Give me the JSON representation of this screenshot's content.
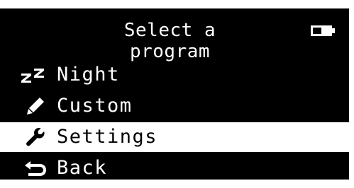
{
  "header": {
    "title": "Select a program",
    "battery_icon": "battery-icon"
  },
  "menu": {
    "items": [
      {
        "label": "Night",
        "icon": "sleep-zz-icon",
        "selected": false
      },
      {
        "label": "Custom",
        "icon": "pencil-icon",
        "selected": false
      },
      {
        "label": "Settings",
        "icon": "wrench-icon",
        "selected": true
      },
      {
        "label": "Back",
        "icon": "back-arrow-icon",
        "selected": false
      }
    ]
  },
  "colors": {
    "background": "#000000",
    "foreground": "#ffffff",
    "selected_background": "#ffffff",
    "selected_foreground": "#000000"
  }
}
